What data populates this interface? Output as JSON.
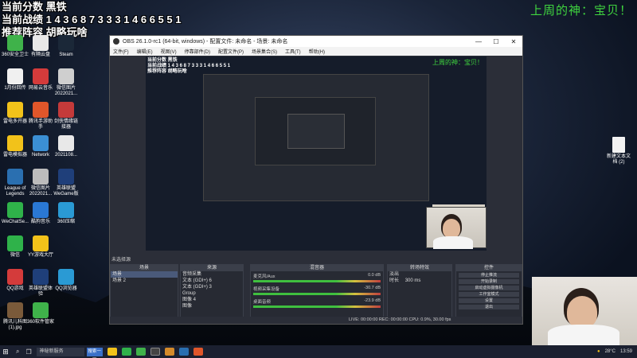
{
  "overlay": {
    "line1": "当前分数 黑铁",
    "line2": "当前战绩 1 4 3 6 8 7 3 3 3 1 4 6 6 5 5 1",
    "line3": "推荐阵容 胡略玩啥",
    "right_banner": "上周的神：宝贝！"
  },
  "desktop_icons": [
    {
      "label": "360安全卫士",
      "color": "#3fb24a",
      "pos": "c0r0"
    },
    {
      "label": "有隔云盘",
      "color": "#e8e8e8",
      "pos": "c1r0"
    },
    {
      "label": "Steam",
      "color": "#1b2838",
      "pos": "c2r0"
    },
    {
      "label": "1月份回传",
      "color": "#f0f0f0",
      "pos": "c0r1"
    },
    {
      "label": "网易云音乐",
      "color": "#d43b3b",
      "pos": "c1r1"
    },
    {
      "label": "微信图片 2022021...",
      "color": "#cfcfcf",
      "pos": "c2r1"
    },
    {
      "label": "雷电多开器",
      "color": "#f2c21a",
      "pos": "c0r2"
    },
    {
      "label": "腾讯手游助手",
      "color": "#e0562a",
      "pos": "c1r2"
    },
    {
      "label": "剑侠情缘链接器",
      "color": "#c43a3a",
      "pos": "c2r2"
    },
    {
      "label": "雷电模拟器",
      "color": "#f2c21a",
      "pos": "c0r3"
    },
    {
      "label": "Network",
      "color": "#3b8fd4",
      "pos": "c1r3"
    },
    {
      "label": "2021108...",
      "color": "#e8e8e8",
      "pos": "c2r3"
    },
    {
      "label": "League of Legends",
      "color": "#2a6fb0",
      "pos": "c0r4"
    },
    {
      "label": "微信图片 2022021...",
      "color": "#bcbcbc",
      "pos": "c1r4"
    },
    {
      "label": "英雄联盟 WeGame版",
      "color": "#1f3f7a",
      "pos": "c2r4"
    },
    {
      "label": "WeChatSe...",
      "color": "#2fb24a",
      "pos": "c0r5"
    },
    {
      "label": "酷狗音乐",
      "color": "#2a78d4",
      "pos": "c1r5"
    },
    {
      "label": "360压缩",
      "color": "#2a9ad4",
      "pos": "c2r5"
    },
    {
      "label": "微信",
      "color": "#2fb24a",
      "pos": "c0r6"
    },
    {
      "label": "YY游戏大厅",
      "color": "#f2c21a",
      "pos": "c1r6"
    },
    {
      "label": "QQ游戏",
      "color": "#d43b3b",
      "pos": "c0r7"
    },
    {
      "label": "英雄联盟体验",
      "color": "#1f3f7a",
      "pos": "c1r7"
    },
    {
      "label": "QQ浏览器",
      "color": "#2a9ad4",
      "pos": "c2r7"
    },
    {
      "label": "腾讯儿科图 (1).jpg",
      "color": "#7a5a3a",
      "pos": "c0r8"
    },
    {
      "label": "360软件管家",
      "color": "#3fb24a",
      "pos": "c1r8"
    }
  ],
  "right_file": {
    "label": "新建文本文档 (2)"
  },
  "obs": {
    "title": "OBS 26.1.0-rc1 (64-bit, windows) - 配置文件: 未命名 - 场景: 未命名",
    "menu": [
      "文件(F)",
      "编辑(E)",
      "视图(V)",
      "停靠部件(D)",
      "配置文件(P)",
      "场景集合(S)",
      "工具(T)",
      "帮助(H)"
    ],
    "no_source": "未选择源",
    "docks": {
      "scenes": {
        "title": "场景",
        "items": [
          "场景",
          "场景 2"
        ]
      },
      "sources": {
        "title": "来源",
        "items": [
          "音频采集",
          "文本 (GDI+) 6",
          "文本 (GDI+) 3",
          "Group",
          "图像 4",
          "图像"
        ]
      },
      "mixer": {
        "title": "混音器",
        "rows": [
          {
            "name": "麦克风/Aux",
            "db": "0.0 dB"
          },
          {
            "name": "视频采集设备",
            "db": "-30.7 dB"
          },
          {
            "name": "桌面音频",
            "db": "-23.9 dB"
          }
        ]
      },
      "transitions": {
        "title": "转场特效",
        "type": "淡出",
        "duration_label": "时长",
        "duration": "300 ms"
      },
      "controls": {
        "title": "控件",
        "buttons": [
          "停止推流",
          "开始录制",
          "启动虚拟摄像机",
          "工作室模式",
          "设置",
          "退出"
        ]
      }
    },
    "status": "LIVE: 00:00:00   REC: 00:00:00   CPU: 0.9%, 30.00 fps"
  },
  "taskbar": {
    "search_placeholder": "神秘新服务",
    "search_btn": "搜索一下",
    "temp": "28°C",
    "time": "13:59"
  },
  "colors": {
    "accent_green": "#3fd43f",
    "taskbar": "#1b2030"
  }
}
